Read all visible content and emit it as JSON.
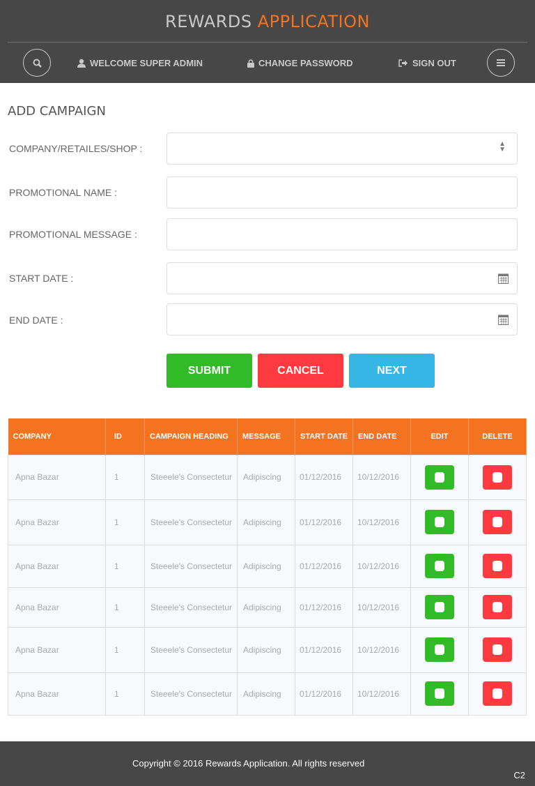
{
  "header": {
    "brand_part1": "REWARDS",
    "brand_part2": "APPLICATION",
    "welcome": "WELCOME SUPER ADMIN",
    "change_password": "CHANGE PASSWORD",
    "sign_out": "SIGN OUT"
  },
  "form": {
    "title": "ADD CAMPAIGN",
    "company_label": "COMPANY/RETAILES/SHOP :",
    "promo_name_label": "PROMOTIONAL NAME :",
    "promo_message_label": "PROMOTIONAL MESSAGE :",
    "start_date_label": "START DATE :",
    "end_date_label": "END DATE :",
    "submit": "SUBMIT",
    "cancel": "CANCEL",
    "next": "NEXT"
  },
  "table": {
    "headers": [
      "COMPANY",
      "ID",
      "CAMPAIGN HEADING",
      "MESSAGE",
      "START DATE",
      "END DATE",
      "EDIT",
      "DELETE"
    ],
    "rows": [
      [
        "Apna Bazar",
        "1",
        "Steeele's Consectetur",
        "Adipiscing",
        "01/12/2016",
        "10/12/2016"
      ],
      [
        "Apna Bazar",
        "1",
        "Steeele's Consectetur",
        "Adipiscing",
        "01/12/2016",
        "10/12/2016"
      ],
      [
        "Apna Bazar",
        "1",
        "Steeele's Consectetur",
        "Adipiscing",
        "01/12/2016",
        "10/12/2016"
      ],
      [
        "Apna Bazar",
        "1",
        "Steeele's Consectetur",
        "Adipiscing",
        "01/12/2016",
        "10/12/2016"
      ],
      [
        "Apna Bazar",
        "1",
        "Steeele's Consectetur",
        "Adipiscing",
        "01/12/2016",
        "10/12/2016"
      ],
      [
        "Apna Bazar",
        "1",
        "Steeele's Consectetur",
        "Adipiscing",
        "01/12/2016",
        "10/12/2016"
      ]
    ]
  },
  "footer": {
    "copyright": "Copyright © 2016 Rewards Application. All rights reserved",
    "corner": "C2"
  }
}
